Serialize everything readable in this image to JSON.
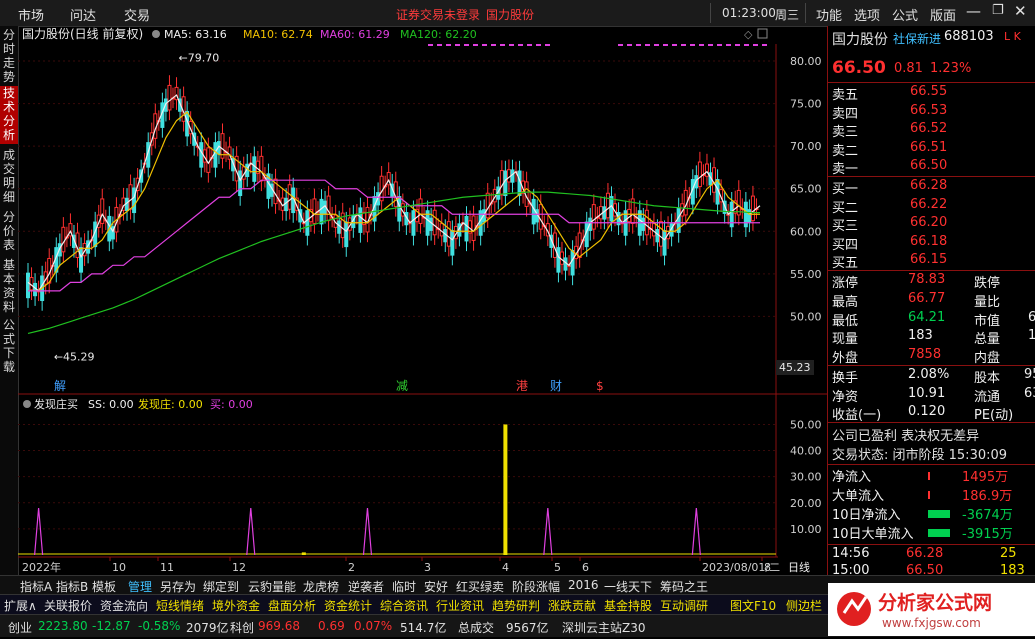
{
  "topbar": {
    "menu_left": [
      "市场",
      "问达",
      "交易"
    ],
    "notice": "证券交易未登录",
    "stock": "国力股份",
    "clock": "01:23:00",
    "weekday": "周三",
    "menu_right": [
      "功能",
      "选项",
      "公式",
      "版面"
    ],
    "window_controls": [
      "minimize-icon",
      "restore-icon",
      "close-icon"
    ]
  },
  "left_tabs": [
    {
      "label": "分时走势",
      "active": false
    },
    {
      "label": "技术分析",
      "active": true
    },
    {
      "label": "成交明细",
      "active": false
    },
    {
      "label": "分价表",
      "active": false
    },
    {
      "label": "基本资料",
      "active": false
    },
    {
      "label": "公式下载",
      "active": false
    }
  ],
  "chart": {
    "title": "国力股份(日线 前复权)",
    "ma_legend": [
      {
        "label": "MA5: 63.16",
        "color": "#f0f0f0"
      },
      {
        "label": "MA10: 62.74",
        "color": "#f0c000"
      },
      {
        "label": "MA60: 61.29",
        "color": "#e040e0"
      },
      {
        "label": "MA120: 62.20",
        "color": "#20c020"
      }
    ],
    "high_marker": "79.70",
    "low_marker": "45.29",
    "current_price_tag": "45.23",
    "event_marks": [
      {
        "label": "解",
        "color": "#40a0ff"
      },
      {
        "label": "减",
        "color": "#30d030"
      },
      {
        "label": "港",
        "color": "#ff4040"
      },
      {
        "label": "财",
        "color": "#40a0ff"
      },
      {
        "label": "$",
        "color": "#ff4040"
      }
    ],
    "indicator_title": "发现庄买",
    "indicator_values": [
      {
        "label": "SS: 0.00",
        "color": "#f0f0f0"
      },
      {
        "label": "发现庄: 0.00",
        "color": "#f0e000"
      },
      {
        "label": "买: 0.00",
        "color": "#e040e0"
      }
    ],
    "x_labels": [
      "2022年",
      "10",
      "11",
      "12",
      "2",
      "3",
      "4",
      "5",
      "6",
      "2023/08/01/二",
      "8",
      "日线"
    ]
  },
  "chart_data": [
    {
      "type": "line",
      "title": "国力股份(日线 前复权)",
      "ylim": [
        43,
        82
      ],
      "y_ticks": [
        "80.00",
        "75.00",
        "70.00",
        "65.00",
        "60.00",
        "55.00",
        "50.00"
      ],
      "series": [
        {
          "name": "MA5",
          "color": "#f0f0f0",
          "values": [
            54,
            53,
            55,
            58,
            60,
            57,
            59,
            62,
            60,
            63,
            64,
            68,
            72,
            75,
            76,
            73,
            70,
            68,
            70,
            69,
            66,
            68,
            67,
            65,
            63,
            64,
            61,
            62,
            63,
            61,
            60,
            62,
            61,
            64,
            66,
            63,
            61,
            62,
            61,
            60,
            59,
            61,
            60,
            62,
            64,
            66,
            67,
            64,
            62,
            60,
            57,
            56,
            58,
            61,
            62,
            63,
            61,
            62,
            61,
            60,
            59,
            61,
            63,
            66,
            67,
            65,
            62,
            63,
            62,
            63
          ]
        },
        {
          "name": "MA10",
          "color": "#f0c000",
          "values": [
            53,
            53,
            54,
            56,
            57,
            58,
            58,
            59,
            61,
            62,
            63,
            65,
            68,
            71,
            73,
            74,
            72,
            70,
            69,
            69,
            68,
            67,
            67,
            66,
            65,
            64,
            63,
            62,
            62,
            62,
            61,
            61,
            61,
            62,
            63,
            64,
            63,
            62,
            62,
            61,
            60,
            60,
            60,
            61,
            62,
            63,
            64,
            65,
            64,
            62,
            60,
            58,
            57,
            58,
            59,
            61,
            62,
            62,
            62,
            61,
            60,
            60,
            61,
            63,
            65,
            66,
            64,
            63,
            62,
            62
          ]
        },
        {
          "name": "MA60",
          "color": "#e040e0",
          "values": [
            53,
            53,
            53,
            53,
            54,
            54,
            55,
            55,
            56,
            56,
            57,
            57,
            58,
            59,
            60,
            61,
            62,
            63,
            64,
            64,
            65,
            65,
            66,
            66,
            66,
            66,
            66,
            66,
            66,
            65,
            65,
            65,
            64,
            64,
            64,
            64,
            63,
            63,
            63,
            63,
            62,
            62,
            62,
            62,
            62,
            62,
            62,
            62,
            62,
            62,
            62,
            61,
            61,
            61,
            61,
            61,
            61,
            61,
            61,
            61,
            61,
            61,
            61,
            61,
            61,
            61,
            61,
            61,
            61,
            61
          ]
        },
        {
          "name": "MA120",
          "color": "#20c020",
          "values": [
            48,
            48.3,
            48.6,
            49,
            49.4,
            49.8,
            50.2,
            50.6,
            51,
            51.5,
            52,
            52.6,
            53.2,
            53.8,
            54.4,
            55,
            55.6,
            56.2,
            56.8,
            57.3,
            57.8,
            58.3,
            58.8,
            59.2,
            59.6,
            60,
            60.4,
            60.8,
            61.2,
            61.5,
            61.8,
            62,
            62.2,
            62.4,
            62.6,
            62.8,
            63,
            63.2,
            63.4,
            63.6,
            63.8,
            64,
            64.1,
            64.2,
            64.3,
            64.4,
            64.5,
            64.6,
            64.6,
            64.6,
            64.5,
            64.4,
            64.3,
            64.2,
            64,
            63.8,
            63.6,
            63.4,
            63.2,
            63,
            62.9,
            62.8,
            62.7,
            62.6,
            62.5,
            62.4,
            62.3,
            62.3,
            62.2,
            62.2
          ]
        }
      ]
    },
    {
      "type": "bar",
      "title": "发现庄买",
      "ylim": [
        0,
        54
      ],
      "y_ticks": [
        "50.00",
        "40.00",
        "30.00",
        "20.00",
        "10.00"
      ],
      "series": [
        {
          "name": "买",
          "color": "#e040e0",
          "spikes": [
            {
              "i": 1,
              "v": 18
            },
            {
              "i": 21,
              "v": 18
            },
            {
              "i": 32,
              "v": 18
            },
            {
              "i": 49,
              "v": 18
            },
            {
              "i": 63,
              "v": 18
            }
          ]
        },
        {
          "name": "发现庄",
          "color": "#f0e000",
          "spikes": [
            {
              "i": 26,
              "v": 1
            },
            {
              "i": 45,
              "v": 50
            }
          ]
        }
      ]
    }
  ],
  "quote": {
    "name": "国力股份",
    "tag": "社保新进",
    "code": "688103",
    "flags": "L K",
    "price": "66.50",
    "change": "0.81",
    "pct": "1.23%",
    "asks": [
      {
        "label": "卖五",
        "price": "66.55"
      },
      {
        "label": "卖四",
        "price": "66.53"
      },
      {
        "label": "卖三",
        "price": "66.52"
      },
      {
        "label": "卖二",
        "price": "66.51"
      },
      {
        "label": "卖一",
        "price": "66.50"
      }
    ],
    "bids": [
      {
        "label": "买一",
        "price": "66.28"
      },
      {
        "label": "买二",
        "price": "66.22"
      },
      {
        "label": "买三",
        "price": "66.20"
      },
      {
        "label": "买四",
        "price": "66.18"
      },
      {
        "label": "买五",
        "price": "66.15"
      }
    ],
    "stats": [
      {
        "l1": "涨停",
        "v1": "78.83",
        "c1": "red",
        "l2": "跌停",
        "v2": ""
      },
      {
        "l1": "最高",
        "v1": "66.77",
        "c1": "red",
        "l2": "量比",
        "v2": ""
      },
      {
        "l1": "最低",
        "v1": "64.21",
        "c1": "green",
        "l2": "市值",
        "v2": "6"
      },
      {
        "l1": "现量",
        "v1": "183",
        "c1": "white",
        "l2": "总量",
        "v2": "1"
      },
      {
        "l1": "外盘",
        "v1": "7858",
        "c1": "red",
        "l2": "内盘",
        "v2": ""
      }
    ],
    "stats2": [
      {
        "l1": "换手",
        "v1": "2.08%",
        "l2": "股本",
        "v2": "95"
      },
      {
        "l1": "净资",
        "v1": "10.91",
        "l2": "流通",
        "v2": "63"
      },
      {
        "l1": "收益(一)",
        "v1": "0.120",
        "l2": "PE(动)",
        "v2": ""
      }
    ],
    "info1": "公司已盈利 表决权无差异",
    "info2": "交易状态: 闭市阶段 15:30:09",
    "flows": [
      {
        "label": "净流入",
        "value": "1495万",
        "color": "red"
      },
      {
        "label": "大单流入",
        "value": "186.9万",
        "color": "red"
      },
      {
        "label": "10日净流入",
        "value": "-3674万",
        "color": "green"
      },
      {
        "label": "10日大单流入",
        "value": "-3915万",
        "color": "green"
      }
    ],
    "ticks": [
      {
        "time": "14:56",
        "price": "66.28",
        "vol": "25"
      },
      {
        "time": "15:00",
        "price": "66.50",
        "vol": "183"
      }
    ]
  },
  "tabs_row1": [
    "指标A",
    "指标B",
    "模板",
    "管理",
    "另存为",
    "绑定到",
    "云豹量能",
    "龙虎榜",
    "逆袭者",
    "临时",
    "安好",
    "红买绿卖",
    "阶段涨幅",
    "2016",
    "一线天下",
    "筹码之王"
  ],
  "tabs_row2": [
    "扩展∧",
    "关联报价",
    "资金流向",
    "短线情绪",
    "境外资金",
    "盘面分析",
    "资金统计",
    "综合资讯",
    "行业资讯",
    "趋势研判",
    "涨跌贡献",
    "基金持股",
    "互动调研",
    "图文F10",
    "侧边栏"
  ],
  "status": {
    "idx1_name": "创业",
    "idx1_value": "2223.80",
    "idx1_change": "-12.87",
    "idx1_pct": "-0.58%",
    "idx1_amount": "2079亿",
    "idx2_name": "科创",
    "idx2_value": "969.68",
    "idx2_change": "0.69",
    "idx2_pct": "0.07%",
    "idx2_amount": "514.7亿",
    "total_label": "总成交",
    "total_value": "9567亿",
    "server": "深圳云主站Z30"
  },
  "logo": {
    "text": "分析家公式网",
    "url": "www.fxjgsw.com"
  }
}
